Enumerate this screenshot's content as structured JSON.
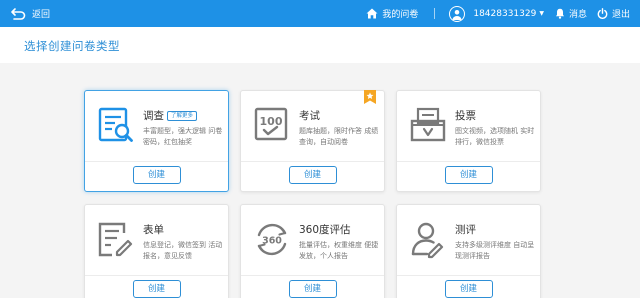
{
  "header": {
    "back_label": "返回",
    "my_surveys_label": "我的问卷",
    "phone": "18428331329",
    "messages_label": "消息",
    "logout_label": "退出"
  },
  "page": {
    "title": "选择创建问卷类型"
  },
  "cards": [
    {
      "name": "调查",
      "badge": "了解更多",
      "desc": "丰富题型，强大逻辑 问卷密码，红包抽奖",
      "button": "创建",
      "icon": "survey-icon",
      "selected": true
    },
    {
      "name": "考试",
      "desc": "题库抽题，限时作答 成绩查询，自动阅卷",
      "button": "创建",
      "icon": "exam-icon"
    },
    {
      "name": "投票",
      "desc": "图文视频，选项随机 实时排行，微信投票",
      "button": "创建",
      "icon": "vote-icon"
    },
    {
      "name": "表单",
      "desc": "信息登记，微信签到 活动报名，意见反馈",
      "button": "创建",
      "icon": "form-icon"
    },
    {
      "name": "360度评估",
      "desc": "批量评估，权重维度 便捷发放，个人报告",
      "button": "创建",
      "icon": "evaluation-360-icon"
    },
    {
      "name": "测评",
      "desc": "支持多级测评维度 自动呈现测评报告",
      "button": "创建",
      "icon": "assessment-icon"
    }
  ],
  "colors": {
    "header": "#1e91e6",
    "accent": "#2e8fd6",
    "ribbon": "#f5a623",
    "icon_blue": "#1e91e6",
    "icon_gray": "#7a7a7a"
  }
}
